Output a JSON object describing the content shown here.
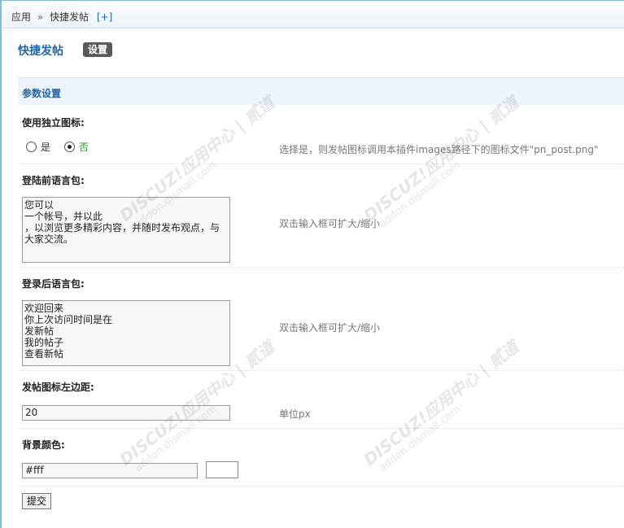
{
  "breadcrumb": {
    "root": "应用",
    "separator": "»",
    "current": "快捷发帖",
    "add_link": "[+]"
  },
  "page": {
    "title": "快捷发帖",
    "settings_tab": "设置"
  },
  "section": {
    "title": "参数设置"
  },
  "fields": {
    "standalone_icon": {
      "label": "使用独立图标:",
      "options": [
        "是",
        "否"
      ],
      "selected": "否",
      "hint": "选择是，则发帖图标调用本插件images路径下的图标文件\"pn_post.png\""
    },
    "before_login_lang": {
      "label": "登陆前语言包:",
      "value": "您可以\n一个帐号，并以此\n，以浏览更多精彩内容，并随时发布观点，与\n大家交流。",
      "hint": "双击输入框可扩大/缩小"
    },
    "after_login_lang": {
      "label": "登录后语言包:",
      "value": "欢迎回来\n你上次访问时间是在\n发新帖\n我的帖子\n查看新帖",
      "hint": "双击输入框可扩大/缩小"
    },
    "icon_left_margin": {
      "label": "发帖图标左边距:",
      "value": "20",
      "hint": "单位px"
    },
    "bg_color": {
      "label": "背景颜色:",
      "value": "#fff",
      "swatch_color": "#ffffff"
    }
  },
  "submit_label": "提交",
  "watermark": {
    "line1": "DISCUZ!应用中心 | 贰道",
    "line2": "addon.dismall.com"
  },
  "colors": {
    "accent": "#2366a8",
    "section_bg": "#eef4fb",
    "selected_option": "#19a119"
  }
}
